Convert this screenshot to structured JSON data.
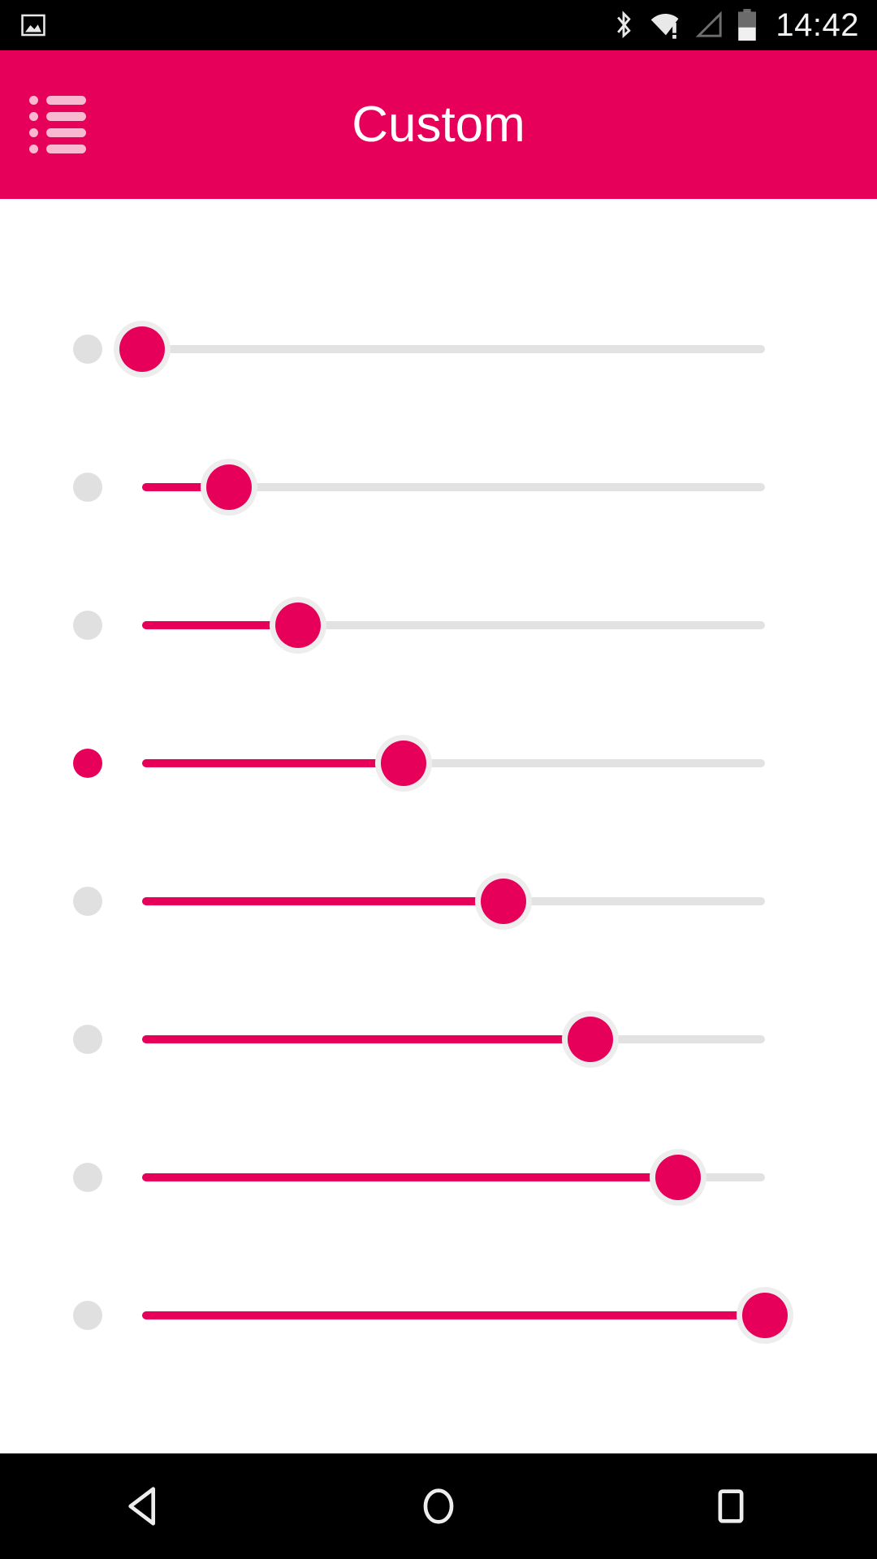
{
  "status_bar": {
    "background": "#000000",
    "notification_icons": [
      {
        "name": "photo-notification-icon",
        "label": "photo"
      }
    ],
    "system_icons": [
      {
        "name": "bluetooth-icon",
        "label": "Bluetooth"
      },
      {
        "name": "wifi-warning-icon",
        "label": "Wi-Fi no internet"
      },
      {
        "name": "cellular-signal-empty-icon",
        "label": "No signal"
      },
      {
        "name": "battery-icon",
        "label": "Battery"
      }
    ],
    "clock": "14:42"
  },
  "app_bar": {
    "title": "Custom",
    "background": "#E6005A",
    "title_color": "#FFFFFF",
    "menu_icon": {
      "name": "list-menu-icon",
      "label": "Menu",
      "rows": 4,
      "color": "#F8B8D0"
    }
  },
  "content": {
    "background": "#FFFFFF",
    "accent_color": "#E6005A",
    "track_color": "#E2E2E2",
    "inactive_indicator_color": "#E0E0E0",
    "thumb_halo_color": "#EDEDED",
    "sliders": [
      {
        "id": "slider-1",
        "value": 0,
        "indicator_active": false
      },
      {
        "id": "slider-2",
        "value": 14,
        "indicator_active": false
      },
      {
        "id": "slider-3",
        "value": 25,
        "indicator_active": false
      },
      {
        "id": "slider-4",
        "value": 42,
        "indicator_active": true
      },
      {
        "id": "slider-5",
        "value": 58,
        "indicator_active": false
      },
      {
        "id": "slider-6",
        "value": 72,
        "indicator_active": false
      },
      {
        "id": "slider-7",
        "value": 86,
        "indicator_active": false
      },
      {
        "id": "slider-8",
        "value": 100,
        "indicator_active": false
      }
    ]
  },
  "nav_bar": {
    "background": "#000000",
    "buttons": [
      {
        "name": "nav-back-button",
        "label": "Back"
      },
      {
        "name": "nav-home-button",
        "label": "Home"
      },
      {
        "name": "nav-recents-button",
        "label": "Recent apps"
      }
    ]
  }
}
